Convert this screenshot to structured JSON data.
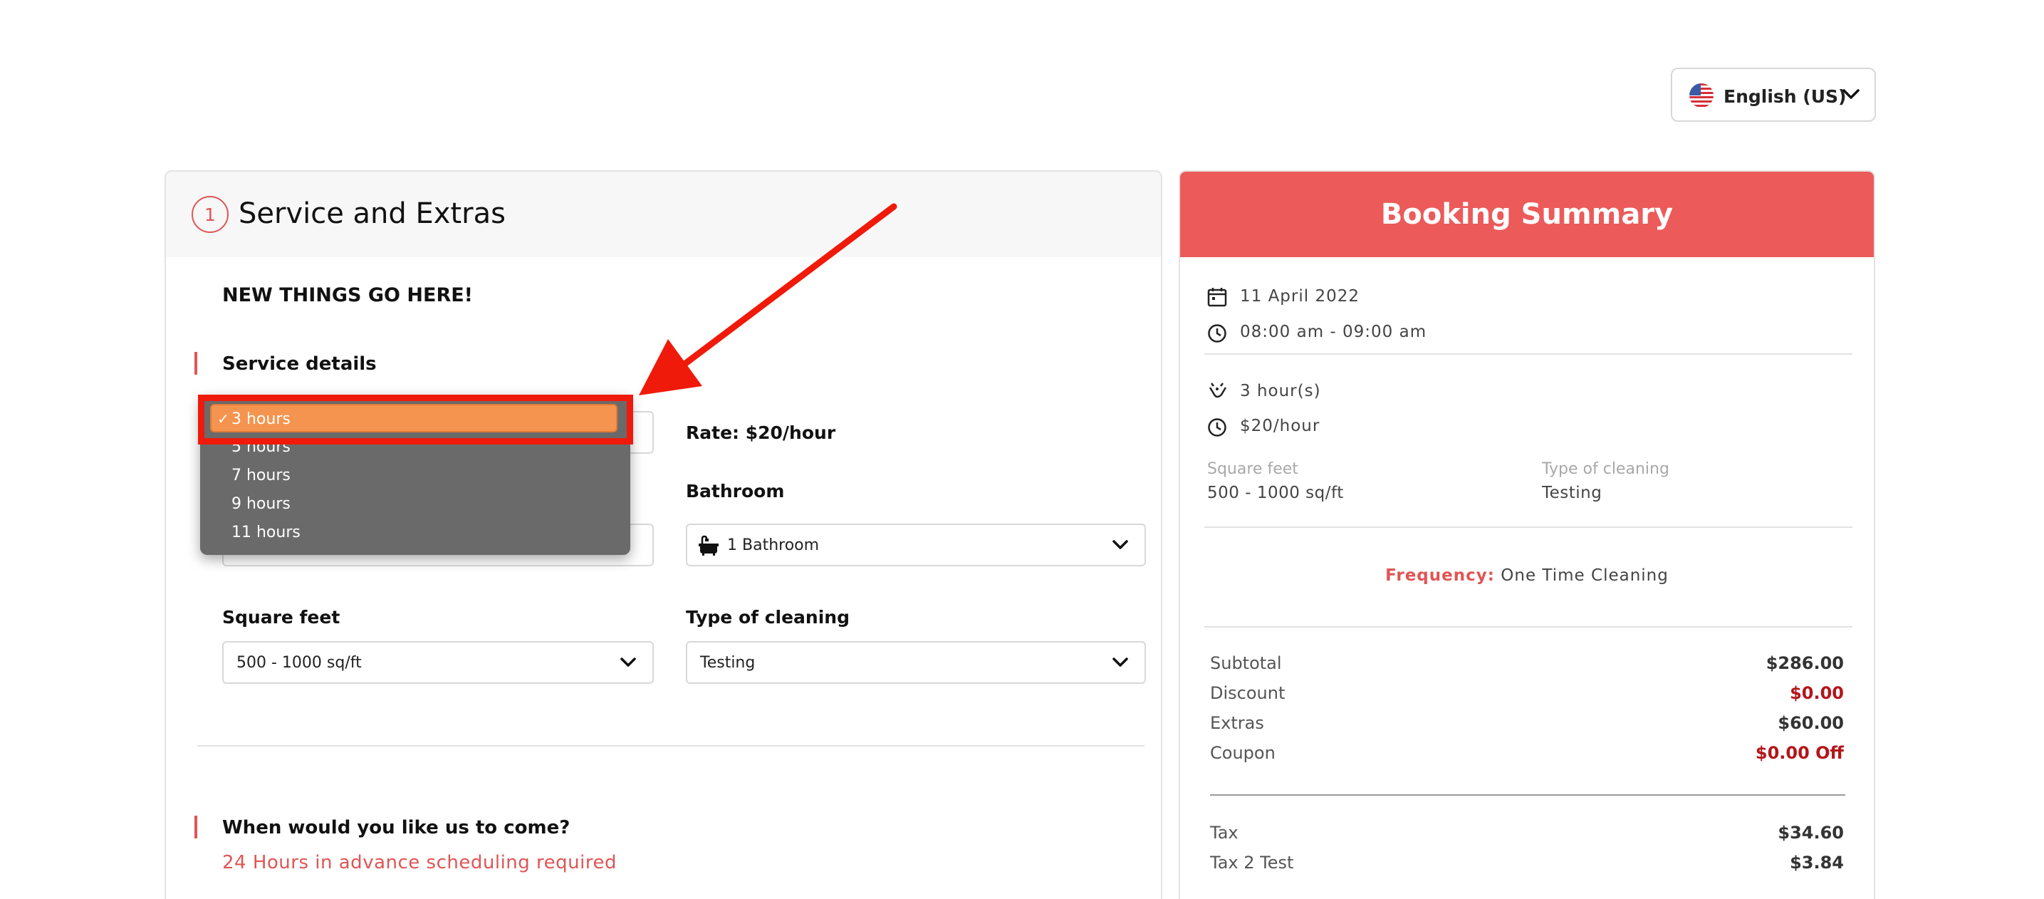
{
  "language": {
    "label": "English (US)",
    "icon": "us-flag-icon"
  },
  "form": {
    "step_number": "1",
    "title": "Service and Extras",
    "custom_text": "NEW THINGS GO HERE!",
    "service_details_label": "Service details",
    "hours_select": {
      "options": [
        "3 hours",
        "5 hours",
        "7 hours",
        "9 hours",
        "11 hours"
      ],
      "selected": "3 hours"
    },
    "rate_text": "Rate: $20/hour",
    "bathroom": {
      "label": "Bathroom",
      "value": "1 Bathroom"
    },
    "square_feet": {
      "label": "Square feet",
      "value": "500 - 1000 sq/ft"
    },
    "cleaning_type": {
      "label": "Type of cleaning",
      "value": "Testing"
    },
    "schedule_label": "When would you like us to come?",
    "schedule_note": "24 Hours in advance scheduling required"
  },
  "summary": {
    "title": "Booking Summary",
    "date": "11 April 2022",
    "time": "08:00 am - 09:00 am",
    "hours": "3 hour(s)",
    "rate": "$20/hour",
    "square_feet_label": "Square feet",
    "square_feet_value": "500 - 1000 sq/ft",
    "cleaning_label": "Type of cleaning",
    "cleaning_value": "Testing",
    "frequency_label": "Frequency:",
    "frequency_value": "One Time Cleaning",
    "rows": [
      {
        "label": "Subtotal",
        "value": "$286.00"
      },
      {
        "label": "Discount",
        "value": "$0.00"
      },
      {
        "label": "Extras",
        "value": "$60.00"
      },
      {
        "label": "Coupon",
        "value": "$0.00 Off"
      }
    ],
    "tax_rows": [
      {
        "label": "Tax",
        "value": "$34.60"
      },
      {
        "label": "Tax 2 Test",
        "value": "$3.84"
      }
    ]
  },
  "colors": {
    "accent": "#ec5a5a",
    "highlight": "#f01a0a",
    "dropdown_selected": "#f5944f",
    "negative": "#b3151a"
  }
}
